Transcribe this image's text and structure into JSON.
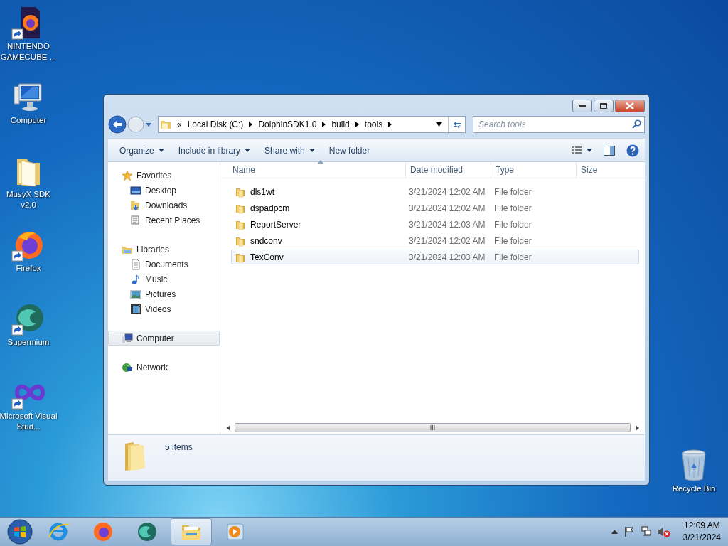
{
  "desktop_icons": [
    {
      "label": "NINTENDO GAMECUBE ...",
      "shortcut": true
    },
    {
      "label": "Computer",
      "shortcut": false
    },
    {
      "label": "MusyX SDK v2.0",
      "shortcut": false
    },
    {
      "label": "Firefox",
      "shortcut": true
    },
    {
      "label": "Supermium",
      "shortcut": true
    },
    {
      "label": "Microsoft Visual Stud...",
      "shortcut": true
    }
  ],
  "recycle_bin": {
    "label": "Recycle Bin"
  },
  "window": {
    "address": {
      "overflow": "«",
      "segments": [
        "Local Disk (C:)",
        "DolphinSDK1.0",
        "build",
        "tools"
      ]
    },
    "search": {
      "placeholder": "Search tools"
    },
    "toolbar": [
      {
        "label": "Organize",
        "dropdown": true
      },
      {
        "label": "Include in library",
        "dropdown": true
      },
      {
        "label": "Share with",
        "dropdown": true
      },
      {
        "label": "New folder",
        "dropdown": false
      }
    ],
    "navigation": [
      {
        "label": "Favorites",
        "selected": false,
        "children": [
          {
            "label": "Desktop",
            "selected": false
          },
          {
            "label": "Downloads",
            "selected": false
          },
          {
            "label": "Recent Places",
            "selected": false
          }
        ]
      },
      {
        "label": "Libraries",
        "selected": false,
        "children": [
          {
            "label": "Documents",
            "selected": false
          },
          {
            "label": "Music",
            "selected": false
          },
          {
            "label": "Pictures",
            "selected": false
          },
          {
            "label": "Videos",
            "selected": false
          }
        ]
      },
      {
        "label": "Computer",
        "selected": true
      },
      {
        "label": "Network",
        "selected": false
      }
    ],
    "table": {
      "columns": [
        "Name",
        "Date modified",
        "Type",
        "Size"
      ],
      "rows": [
        {
          "name": "dls1wt",
          "date": "3/21/2024 12:02 AM",
          "type": "File folder",
          "selected": false
        },
        {
          "name": "dspadpcm",
          "date": "3/21/2024 12:02 AM",
          "type": "File folder",
          "selected": false
        },
        {
          "name": "ReportServer",
          "date": "3/21/2024 12:03 AM",
          "type": "File folder",
          "selected": false
        },
        {
          "name": "sndconv",
          "date": "3/21/2024 12:02 AM",
          "type": "File folder",
          "selected": false
        },
        {
          "name": "TexConv",
          "date": "3/21/2024 12:03 AM",
          "type": "File folder",
          "selected": true
        }
      ]
    },
    "status": "5 items"
  },
  "taskbar": {
    "apps": [
      {
        "active": false
      },
      {
        "active": false
      },
      {
        "active": false
      },
      {
        "active": true
      },
      {
        "active": false
      }
    ],
    "time": "12:09 AM",
    "date": "3/21/2024"
  }
}
